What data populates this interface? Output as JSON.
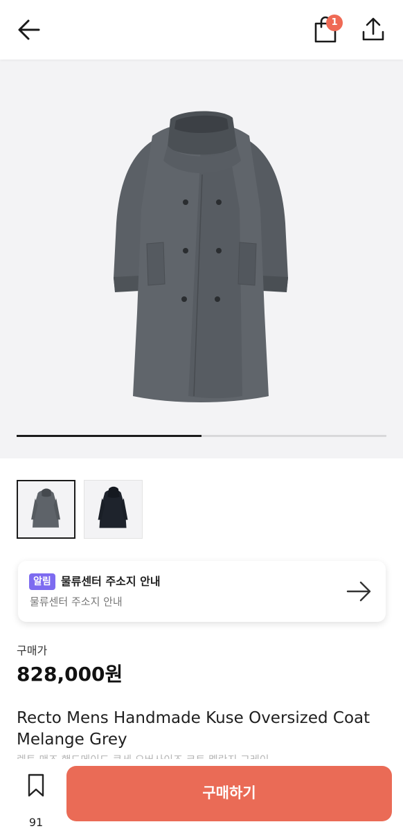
{
  "header": {
    "cart_count": "1"
  },
  "gallery": {
    "progress": 0.5,
    "thumbnails": [
      {
        "variant": "melange-grey",
        "active": true
      },
      {
        "variant": "black",
        "active": false
      }
    ]
  },
  "notice": {
    "tag": "알림",
    "title": "물류센터 주소지 안내",
    "subtitle": "물류센터 주소지 안내"
  },
  "pricing": {
    "label": "구매가",
    "price": "828,000원"
  },
  "product": {
    "name": "Recto Mens Handmade Kuse Oversized Coat Melange Grey",
    "name_ko": "렉토 맨즈 핸드메이드 쿠세 오버사이즈 코트 멜란지 그레이"
  },
  "bottom_bar": {
    "bookmark_count": "91",
    "buy_label": "구매하기"
  },
  "colors": {
    "accent": "#ea6b56",
    "badge": "#ef6a55",
    "tag": "#7d6bf0"
  }
}
